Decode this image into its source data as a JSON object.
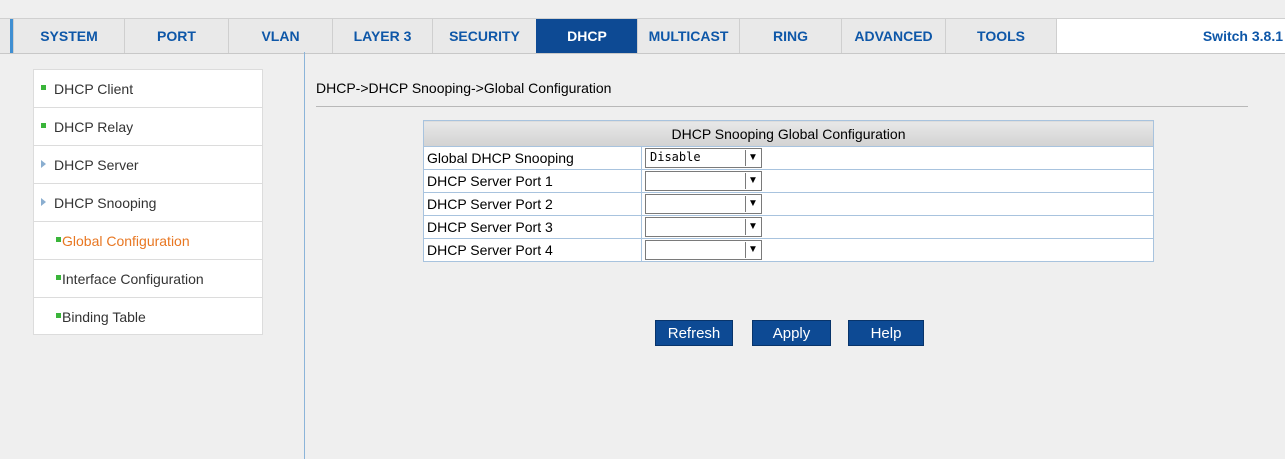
{
  "nav": {
    "tabs": [
      {
        "label": "SYSTEM"
      },
      {
        "label": "PORT"
      },
      {
        "label": "VLAN"
      },
      {
        "label": "LAYER 3"
      },
      {
        "label": "SECURITY"
      },
      {
        "label": "DHCP"
      },
      {
        "label": "MULTICAST"
      },
      {
        "label": "RING"
      },
      {
        "label": "ADVANCED"
      },
      {
        "label": "TOOLS"
      }
    ],
    "active_tab": "DHCP",
    "version": "Switch 3.8.1"
  },
  "sidebar": {
    "items": [
      {
        "label": "DHCP Client",
        "icon": "square-bullet-icon"
      },
      {
        "label": "DHCP Relay",
        "icon": "square-bullet-icon"
      },
      {
        "label": "DHCP Server",
        "icon": "triangle-expand-icon"
      },
      {
        "label": "DHCP Snooping",
        "icon": "triangle-expand-icon"
      },
      {
        "label": "Global Configuration",
        "icon": "square-bullet-icon"
      },
      {
        "label": "Interface Configuration",
        "icon": "square-bullet-icon"
      },
      {
        "label": "Binding Table",
        "icon": "square-bullet-icon"
      }
    ],
    "current_item": "Global Configuration"
  },
  "main": {
    "breadcrumb": "DHCP->DHCP Snooping->Global Configuration",
    "table_title": "DHCP Snooping Global Configuration",
    "rows": [
      {
        "label": "Global DHCP Snooping",
        "value": "Disable"
      },
      {
        "label": "DHCP Server Port 1",
        "value": ""
      },
      {
        "label": "DHCP Server Port 2",
        "value": ""
      },
      {
        "label": "DHCP Server Port 3",
        "value": ""
      },
      {
        "label": "DHCP Server Port 4",
        "value": ""
      }
    ],
    "buttons": {
      "refresh": "Refresh",
      "apply": "Apply",
      "help": "Help"
    }
  },
  "colors": {
    "accent": "#0d4a94",
    "current_item": "#e87722",
    "bullet": "#3ab53a"
  }
}
